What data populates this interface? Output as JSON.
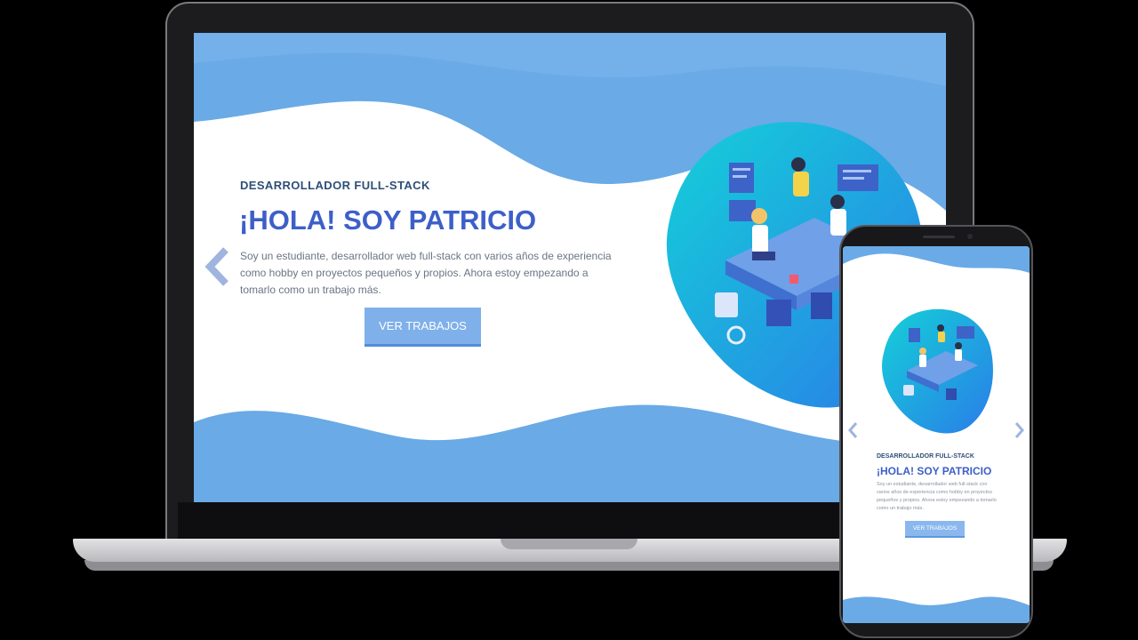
{
  "hero": {
    "subtitle": "DESARROLLADOR FULL-STACK",
    "title": "¡HOLA! SOY PATRICIO",
    "description": "Soy un estudiante, desarrollador web full-stack con varios años de experiencia como hobby en proyectos pequeños y propios. Ahora estoy empezando a tomarlo como un trabajo más.",
    "button_label": "VER TRABAJOS"
  },
  "mobile": {
    "subtitle": "DESARROLLADOR FULL-STACK",
    "title": "¡HOLA! SOY PATRICIO",
    "description": "Soy un estudiante, desarrollador web full-stack con varios años de experiencia como hobby en proyectos pequeños y propios. Ahora estoy empezando a tomarlo como un trabajo más.",
    "button_label": "VER TRABAJOS"
  },
  "icons": {
    "desktop_prev": "chevron-left-icon",
    "mobile_prev": "chevron-left-icon",
    "mobile_next": "chevron-right-icon",
    "illustration": "developers-isometric-illustration"
  },
  "colors": {
    "wave_blue": "#6aaae6",
    "title_blue": "#3d5fc8",
    "subtitle_navy": "#2e4f76",
    "button_blue": "#7fb0ea",
    "blob_teal": "#14c8d8",
    "blob_blue": "#2a86e8"
  }
}
